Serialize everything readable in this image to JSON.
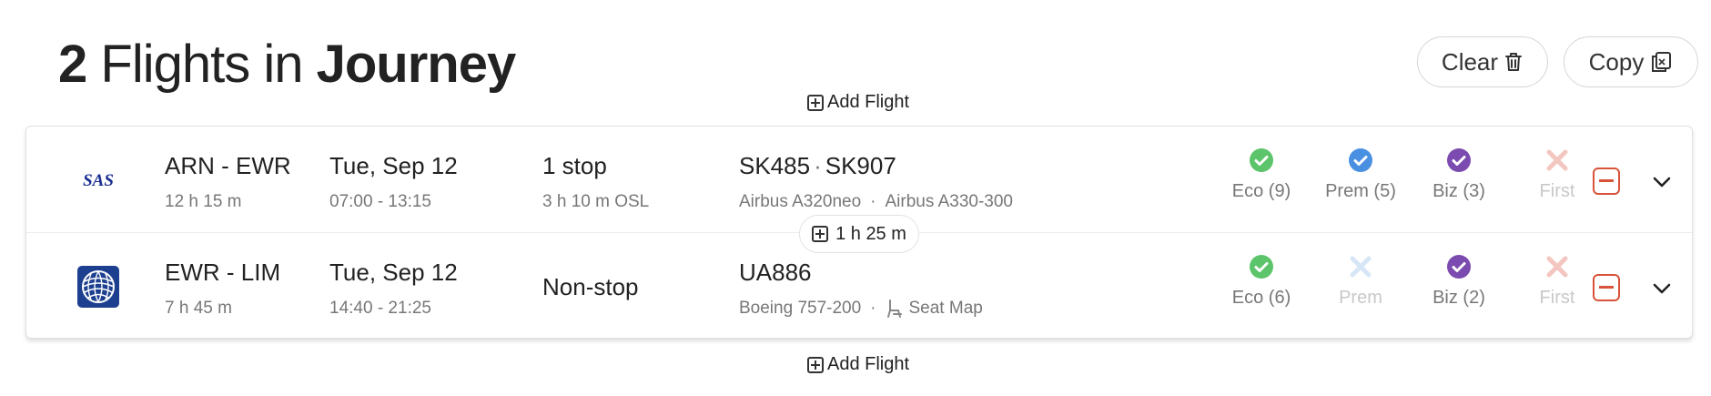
{
  "header": {
    "count": "2",
    "mid_text": "Flights in",
    "bold_text": "Journey"
  },
  "toolbar": {
    "clear_label": "Clear",
    "copy_label": "Copy"
  },
  "add_flight_label": "Add Flight",
  "layover_pill": "1 h 25 m",
  "flights": [
    {
      "airline": "SAS",
      "route": "ARN - EWR",
      "duration": "12 h 15 m",
      "date": "Tue, Sep 12",
      "times": "07:00 - 13:15",
      "stops": "1 stop",
      "layover": "3 h 10 m  OSL",
      "flight_numbers": [
        "SK485",
        "SK907"
      ],
      "aircraft": [
        "Airbus A320neo",
        "Airbus A330-300"
      ],
      "cabins": [
        {
          "label": "Eco (9)",
          "status": "available",
          "color": "#5cc46a"
        },
        {
          "label": "Prem (5)",
          "status": "available",
          "color": "#4a90e2"
        },
        {
          "label": "Biz (3)",
          "status": "available",
          "color": "#7b4bb0"
        },
        {
          "label": "First",
          "status": "unavailable",
          "color": "#f4c6c0"
        }
      ]
    },
    {
      "airline": "United",
      "route": "EWR - LIM",
      "duration": "7 h 45 m",
      "date": "Tue, Sep 12",
      "times": "14:40 - 21:25",
      "stops": "Non-stop",
      "flight_numbers": [
        "UA886"
      ],
      "aircraft": [
        "Boeing 757-200"
      ],
      "seat_map_label": "Seat Map",
      "cabins": [
        {
          "label": "Eco (6)",
          "status": "available",
          "color": "#5cc46a"
        },
        {
          "label": "Prem",
          "status": "unavailable",
          "color": "#d7e6f6"
        },
        {
          "label": "Biz (2)",
          "status": "available",
          "color": "#7b4bb0"
        },
        {
          "label": "First",
          "status": "unavailable",
          "color": "#f4c6c0"
        }
      ]
    }
  ],
  "colors": {
    "eco": "#5cc46a",
    "prem": "#4a90e2",
    "biz": "#7b4bb0",
    "first_off": "#f4c6c0",
    "prem_off": "#d7e6f6",
    "remove": "#d9533a",
    "sas_blue": "#1a2d91",
    "united_blue": "#1d3f8f"
  }
}
